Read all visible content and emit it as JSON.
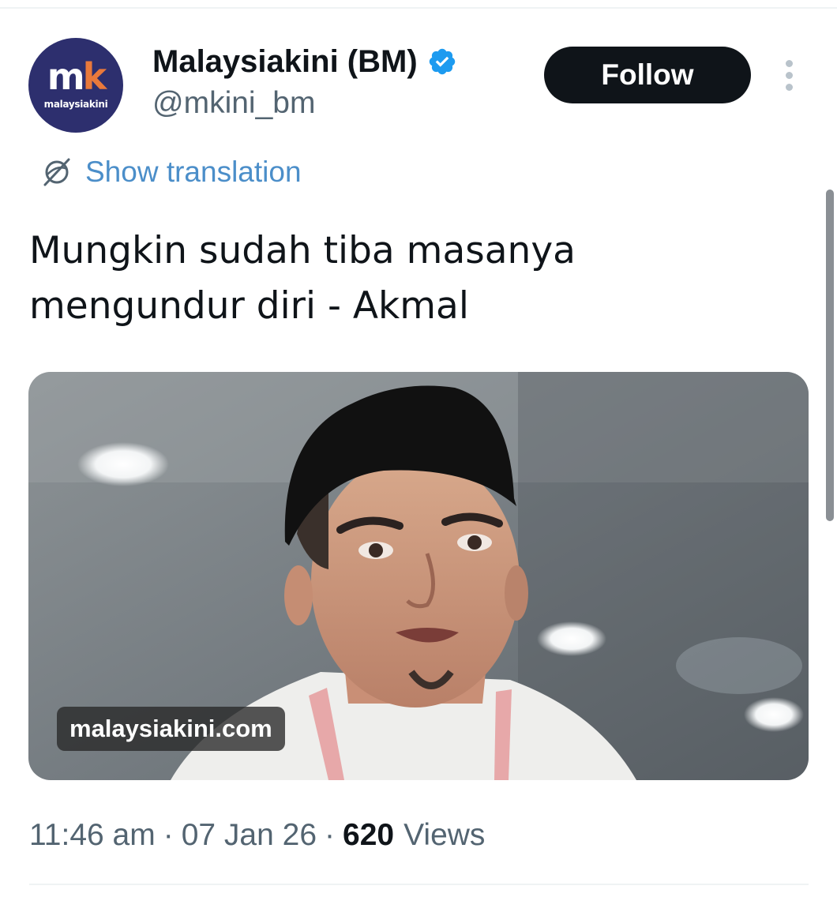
{
  "author": {
    "avatar_monogram": "mk",
    "avatar_brand": "malaysiakini",
    "display_name": "Malaysiakini (BM)",
    "handle": "@mkini_bm",
    "verified": true,
    "verified_icon": "verified-badge-icon",
    "verified_color": "#1d9bf0"
  },
  "follow_label": "Follow",
  "more_icon": "more-vertical-icon",
  "translation": {
    "icon": "translate-globe-icon",
    "label": "Show translation"
  },
  "tweet": {
    "text_line1": "Mungkin sudah tiba masanya",
    "text_line2": "mengundur diri - Akmal"
  },
  "media": {
    "domain_label": "malaysiakini.com",
    "description_icon": "link-card-photo"
  },
  "meta": {
    "time": "11:46 am",
    "date": "07 Jan 26",
    "separator": "·",
    "views_count": "620",
    "views_label": "Views"
  },
  "colors": {
    "text": "#0f1419",
    "secondary": "#536471",
    "link": "#4b8ec9",
    "avatar_bg": "#2d2f6e",
    "avatar_accent": "#e9793b"
  }
}
